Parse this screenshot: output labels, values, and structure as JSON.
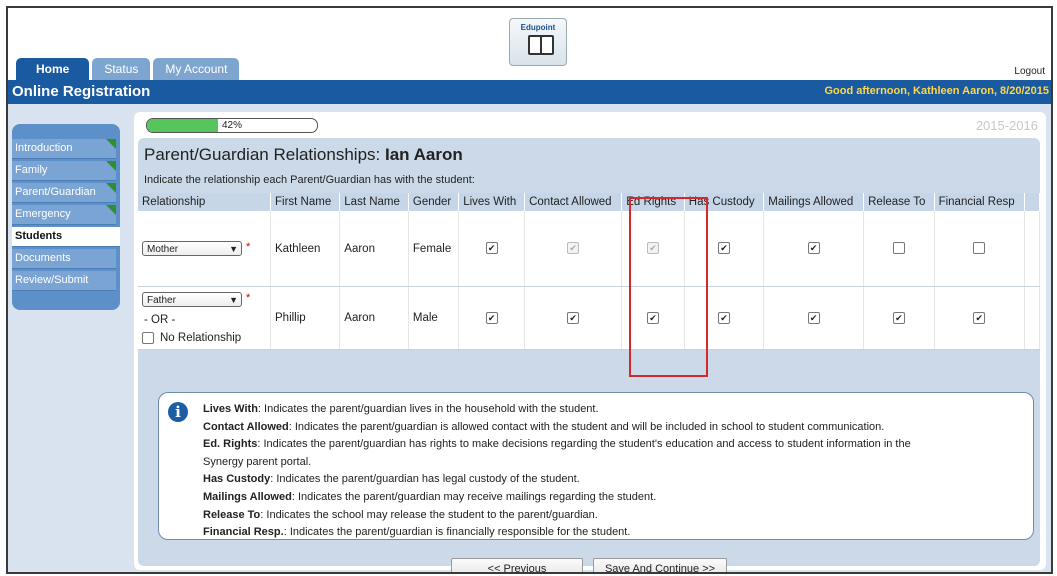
{
  "header": {
    "logo_text": "Edupoint",
    "tabs": [
      {
        "label": "Home",
        "active": true
      },
      {
        "label": "Status",
        "active": false
      },
      {
        "label": "My Account",
        "active": false
      }
    ],
    "logout": "Logout",
    "title": "Online Registration",
    "greeting": "Good afternoon, Kathleen Aaron, 8/20/2015"
  },
  "sidebar": {
    "items": [
      {
        "label": "Introduction",
        "completed": true,
        "active": false
      },
      {
        "label": "Family",
        "completed": true,
        "active": false
      },
      {
        "label": "Parent/Guardian",
        "completed": true,
        "active": false
      },
      {
        "label": "Emergency",
        "completed": true,
        "active": false
      },
      {
        "label": "Students",
        "completed": false,
        "active": true
      },
      {
        "label": "Documents",
        "completed": false,
        "active": false
      },
      {
        "label": "Review/Submit",
        "completed": false,
        "active": false
      }
    ]
  },
  "progress": {
    "label": "42%",
    "value": 0.42
  },
  "school_year": "2015-2016",
  "panel": {
    "title_prefix": "Parent/Guardian Relationships:",
    "student_name": "Ian Aaron",
    "instruction": "Indicate the relationship each Parent/Guardian has with the student:"
  },
  "table": {
    "headers": [
      "Relationship",
      "First Name",
      "Last Name",
      "Gender",
      "Lives With",
      "Contact Allowed",
      "Ed Rights",
      "Has Custody",
      "Mailings Allowed",
      "Release To",
      "Financial Resp"
    ],
    "required_mark": "*",
    "or_text": "- OR -",
    "no_relationship_label": "No Relationship",
    "rows": [
      {
        "relationship": "Mother",
        "first": "Kathleen",
        "last": "Aaron",
        "gender": "Female"
      },
      {
        "relationship": "Father",
        "first": "Phillip",
        "last": "Aaron",
        "gender": "Male"
      }
    ]
  },
  "legend": [
    {
      "term": "Lives With",
      "text": ": Indicates the parent/guardian lives in the household with the student."
    },
    {
      "term": "Contact Allowed",
      "text": ": Indicates the parent/guardian is allowed contact with the student and will be included in school to student communication."
    },
    {
      "term": "Ed. Rights",
      "text": ": Indicates the parent/guardian has rights to make decisions regarding the student's education and access to student information in the"
    },
    {
      "term": "",
      "text": "Synergy parent portal."
    },
    {
      "term": "Has Custody",
      "text": ": Indicates the parent/guardian has legal custody of the student."
    },
    {
      "term": "Mailings Allowed",
      "text": ": Indicates the parent/guardian may receive mailings regarding the student."
    },
    {
      "term": "Release To",
      "text": ": Indicates the school may release the student to the parent/guardian."
    },
    {
      "term": "Financial Resp.",
      "text": ": Indicates the parent/guardian is financially responsible for the student."
    }
  ],
  "buttons": {
    "previous": "<< Previous",
    "save_continue": "Save And Continue >>"
  },
  "colors": {
    "brand_blue": "#1a5aa0",
    "greeting_yellow": "#ffd74a",
    "progress_green": "#56c65c",
    "highlight_red": "#d4282b"
  }
}
